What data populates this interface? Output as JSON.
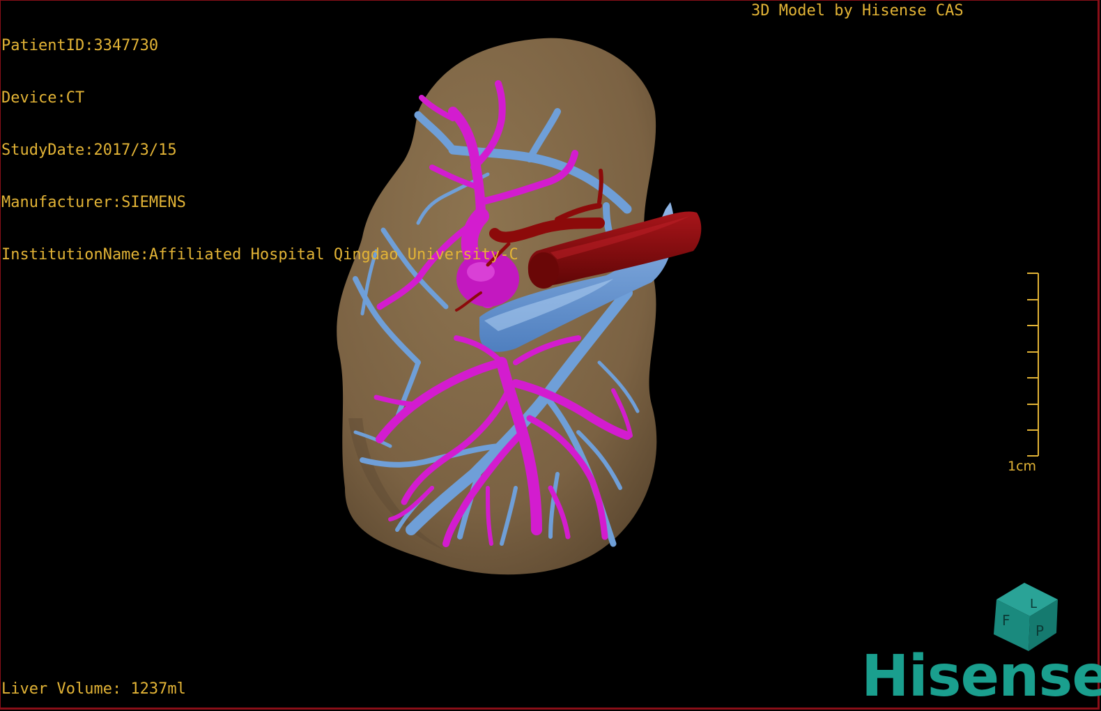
{
  "info": {
    "patient_id": "PatientID:3347730",
    "device": "Device:CT",
    "study_date": "StudyDate:2017/3/15",
    "manufacturer": "Manufacturer:SIEMENS",
    "institution": "InstitutionName:Affiliated Hospital Qingdao University-C"
  },
  "credit": "3D Model by Hisense CAS",
  "volume": "Liver Volume: 1237ml",
  "scale": {
    "label": "1cm"
  },
  "orientation_cube": {
    "faces": [
      "F",
      "L",
      "P"
    ],
    "color": "#1a8a7e"
  },
  "logo": {
    "text": "Hisense",
    "color": "#1a9f8e"
  },
  "colors": {
    "text": "#e3b436",
    "liver": "#7d6443",
    "portal_vein": "#d31ccf",
    "hepatic_vein": "#6f9fd8",
    "artery": "#8c0a0a",
    "frame": "#8a0f18"
  },
  "icons": [
    "orientation-cube-icon",
    "scale-bar-icon"
  ]
}
